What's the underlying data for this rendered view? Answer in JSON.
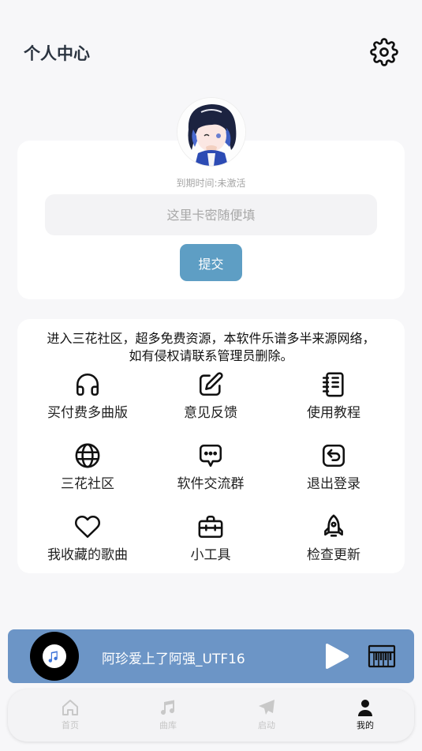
{
  "header": {
    "title": "个人中心",
    "settings_icon": "gear-icon"
  },
  "profile": {
    "expire_text": "到期时间:未激活",
    "card_placeholder": "这里卡密随便填",
    "submit_label": "提交"
  },
  "notice": {
    "line1": "进入三花社区，超多免费资源，本软件乐谱多半来源网络，",
    "line2": "如有侵权请联系管理员删除。"
  },
  "menu": {
    "items": [
      {
        "label": "买付费多曲版",
        "icon": "headphones-icon"
      },
      {
        "label": "意见反馈",
        "icon": "edit-icon"
      },
      {
        "label": "使用教程",
        "icon": "notebook-icon"
      },
      {
        "label": "三花社区",
        "icon": "globe-icon"
      },
      {
        "label": "软件交流群",
        "icon": "chat-icon"
      },
      {
        "label": "退出登录",
        "icon": "logout-icon"
      },
      {
        "label": "我收藏的歌曲",
        "icon": "heart-icon"
      },
      {
        "label": "小工具",
        "icon": "toolbox-icon"
      },
      {
        "label": "检查更新",
        "icon": "rocket-icon"
      }
    ]
  },
  "player": {
    "song_title": "阿珍爱上了阿强_UTF16",
    "play_icon": "play-icon",
    "piano_icon": "piano-icon"
  },
  "tabs": [
    {
      "label": "首页",
      "icon": "home-icon",
      "active": false
    },
    {
      "label": "曲库",
      "icon": "music-note-icon",
      "active": false
    },
    {
      "label": "启动",
      "icon": "send-icon",
      "active": false
    },
    {
      "label": "我的",
      "icon": "user-icon",
      "active": true
    }
  ],
  "colors": {
    "accent": "#5e9ec4",
    "player_bg": "#6c95c6",
    "page_bg": "#f7f7f9"
  }
}
